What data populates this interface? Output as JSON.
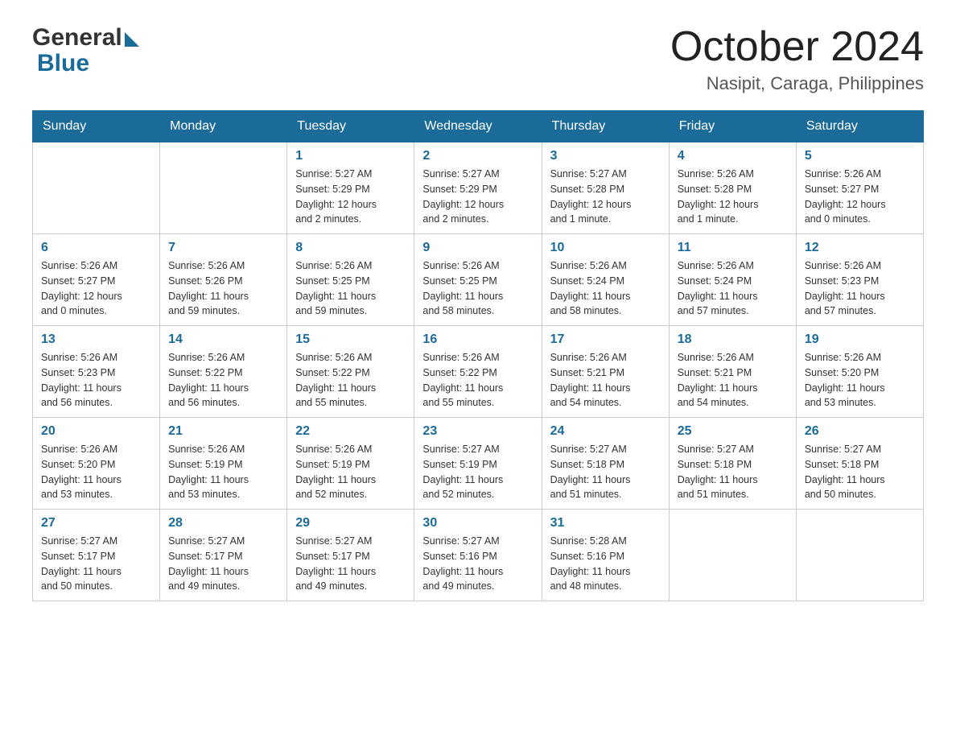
{
  "header": {
    "month_year": "October 2024",
    "location": "Nasipit, Caraga, Philippines",
    "logo_general": "General",
    "logo_blue": "Blue"
  },
  "weekdays": [
    "Sunday",
    "Monday",
    "Tuesday",
    "Wednesday",
    "Thursday",
    "Friday",
    "Saturday"
  ],
  "weeks": [
    [
      {
        "day": "",
        "info": ""
      },
      {
        "day": "",
        "info": ""
      },
      {
        "day": "1",
        "info": "Sunrise: 5:27 AM\nSunset: 5:29 PM\nDaylight: 12 hours\nand 2 minutes."
      },
      {
        "day": "2",
        "info": "Sunrise: 5:27 AM\nSunset: 5:29 PM\nDaylight: 12 hours\nand 2 minutes."
      },
      {
        "day": "3",
        "info": "Sunrise: 5:27 AM\nSunset: 5:28 PM\nDaylight: 12 hours\nand 1 minute."
      },
      {
        "day": "4",
        "info": "Sunrise: 5:26 AM\nSunset: 5:28 PM\nDaylight: 12 hours\nand 1 minute."
      },
      {
        "day": "5",
        "info": "Sunrise: 5:26 AM\nSunset: 5:27 PM\nDaylight: 12 hours\nand 0 minutes."
      }
    ],
    [
      {
        "day": "6",
        "info": "Sunrise: 5:26 AM\nSunset: 5:27 PM\nDaylight: 12 hours\nand 0 minutes."
      },
      {
        "day": "7",
        "info": "Sunrise: 5:26 AM\nSunset: 5:26 PM\nDaylight: 11 hours\nand 59 minutes."
      },
      {
        "day": "8",
        "info": "Sunrise: 5:26 AM\nSunset: 5:25 PM\nDaylight: 11 hours\nand 59 minutes."
      },
      {
        "day": "9",
        "info": "Sunrise: 5:26 AM\nSunset: 5:25 PM\nDaylight: 11 hours\nand 58 minutes."
      },
      {
        "day": "10",
        "info": "Sunrise: 5:26 AM\nSunset: 5:24 PM\nDaylight: 11 hours\nand 58 minutes."
      },
      {
        "day": "11",
        "info": "Sunrise: 5:26 AM\nSunset: 5:24 PM\nDaylight: 11 hours\nand 57 minutes."
      },
      {
        "day": "12",
        "info": "Sunrise: 5:26 AM\nSunset: 5:23 PM\nDaylight: 11 hours\nand 57 minutes."
      }
    ],
    [
      {
        "day": "13",
        "info": "Sunrise: 5:26 AM\nSunset: 5:23 PM\nDaylight: 11 hours\nand 56 minutes."
      },
      {
        "day": "14",
        "info": "Sunrise: 5:26 AM\nSunset: 5:22 PM\nDaylight: 11 hours\nand 56 minutes."
      },
      {
        "day": "15",
        "info": "Sunrise: 5:26 AM\nSunset: 5:22 PM\nDaylight: 11 hours\nand 55 minutes."
      },
      {
        "day": "16",
        "info": "Sunrise: 5:26 AM\nSunset: 5:22 PM\nDaylight: 11 hours\nand 55 minutes."
      },
      {
        "day": "17",
        "info": "Sunrise: 5:26 AM\nSunset: 5:21 PM\nDaylight: 11 hours\nand 54 minutes."
      },
      {
        "day": "18",
        "info": "Sunrise: 5:26 AM\nSunset: 5:21 PM\nDaylight: 11 hours\nand 54 minutes."
      },
      {
        "day": "19",
        "info": "Sunrise: 5:26 AM\nSunset: 5:20 PM\nDaylight: 11 hours\nand 53 minutes."
      }
    ],
    [
      {
        "day": "20",
        "info": "Sunrise: 5:26 AM\nSunset: 5:20 PM\nDaylight: 11 hours\nand 53 minutes."
      },
      {
        "day": "21",
        "info": "Sunrise: 5:26 AM\nSunset: 5:19 PM\nDaylight: 11 hours\nand 53 minutes."
      },
      {
        "day": "22",
        "info": "Sunrise: 5:26 AM\nSunset: 5:19 PM\nDaylight: 11 hours\nand 52 minutes."
      },
      {
        "day": "23",
        "info": "Sunrise: 5:27 AM\nSunset: 5:19 PM\nDaylight: 11 hours\nand 52 minutes."
      },
      {
        "day": "24",
        "info": "Sunrise: 5:27 AM\nSunset: 5:18 PM\nDaylight: 11 hours\nand 51 minutes."
      },
      {
        "day": "25",
        "info": "Sunrise: 5:27 AM\nSunset: 5:18 PM\nDaylight: 11 hours\nand 51 minutes."
      },
      {
        "day": "26",
        "info": "Sunrise: 5:27 AM\nSunset: 5:18 PM\nDaylight: 11 hours\nand 50 minutes."
      }
    ],
    [
      {
        "day": "27",
        "info": "Sunrise: 5:27 AM\nSunset: 5:17 PM\nDaylight: 11 hours\nand 50 minutes."
      },
      {
        "day": "28",
        "info": "Sunrise: 5:27 AM\nSunset: 5:17 PM\nDaylight: 11 hours\nand 49 minutes."
      },
      {
        "day": "29",
        "info": "Sunrise: 5:27 AM\nSunset: 5:17 PM\nDaylight: 11 hours\nand 49 minutes."
      },
      {
        "day": "30",
        "info": "Sunrise: 5:27 AM\nSunset: 5:16 PM\nDaylight: 11 hours\nand 49 minutes."
      },
      {
        "day": "31",
        "info": "Sunrise: 5:28 AM\nSunset: 5:16 PM\nDaylight: 11 hours\nand 48 minutes."
      },
      {
        "day": "",
        "info": ""
      },
      {
        "day": "",
        "info": ""
      }
    ]
  ]
}
